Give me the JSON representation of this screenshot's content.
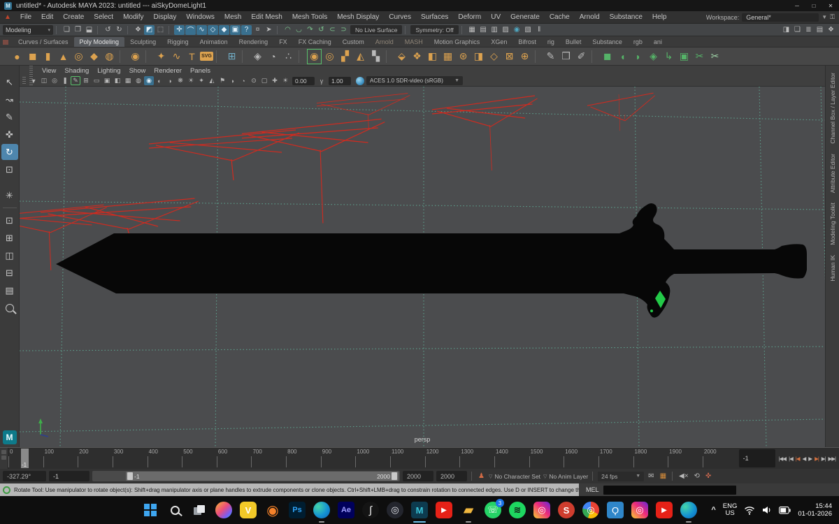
{
  "colors": {
    "viewport_bg": "#4b4c4e",
    "grid": "#5fa893",
    "wire": "#cf2b20",
    "sword": "#070707",
    "gem": "#23c948",
    "accent": "#4e86ad"
  },
  "window": {
    "title": "untitled* - Autodesk MAYA 2023: untitled --- aiSkyDomeLight1",
    "minimize": "─",
    "maximize": "□",
    "close": "✕"
  },
  "menubar": {
    "items": [
      "File",
      "Edit",
      "Create",
      "Select",
      "Modify",
      "Display",
      "Windows",
      "Mesh",
      "Edit Mesh",
      "Mesh Tools",
      "Mesh Display",
      "Curves",
      "Surfaces",
      "Deform",
      "UV",
      "Generate",
      "Cache",
      "Arnold",
      "Substance",
      "Help"
    ],
    "workspace_label": "Workspace:",
    "workspace_value": "General*"
  },
  "statusline": {
    "mode": "Modeling",
    "no_live_surface": "No Live Surface",
    "symmetry": "Symmetry: Off",
    "file_icons": [
      {
        "name": "new-scene-icon",
        "glyph": "❏"
      },
      {
        "name": "open-scene-icon",
        "glyph": "❐"
      },
      {
        "name": "save-scene-icon",
        "glyph": "⬓"
      }
    ],
    "edit_icons": [
      {
        "name": "undo-icon",
        "glyph": "↺"
      },
      {
        "name": "redo-icon",
        "glyph": "↻"
      }
    ],
    "mask_icons": [
      {
        "name": "select-hierarchy-icon",
        "glyph": "❖"
      },
      {
        "name": "select-object-icon",
        "glyph": "◩",
        "state": "active"
      },
      {
        "name": "select-component-icon",
        "glyph": "⬚"
      }
    ],
    "snap_icons": [
      {
        "name": "snap-grid-icon",
        "glyph": "✛",
        "state": "active"
      },
      {
        "name": "snap-curve-icon",
        "glyph": "⌒",
        "state": "active"
      },
      {
        "name": "snap-point-icon",
        "glyph": "∿",
        "state": "active"
      },
      {
        "name": "snap-projected-center-icon",
        "glyph": "◇",
        "state": "active"
      },
      {
        "name": "snap-view-plane-icon",
        "glyph": "◆",
        "state": "active"
      },
      {
        "name": "make-live-icon",
        "glyph": "▣",
        "state": "active"
      },
      {
        "name": "snap-help-icon",
        "glyph": "?",
        "state": "active"
      },
      {
        "name": "lock-selection-icon",
        "glyph": "¤"
      },
      {
        "name": "highlight-selection-icon",
        "glyph": "➤"
      }
    ],
    "surf_icons": [
      {
        "name": "construction-history-icon",
        "glyph": "◠",
        "color": "#7fc98f"
      },
      {
        "name": "curve-arc-icon",
        "glyph": "◡",
        "color": "#7fc98f"
      },
      {
        "name": "curve-redo-icon",
        "glyph": "↷",
        "color": "#7fc98f"
      },
      {
        "name": "curve-undo-icon",
        "glyph": "↺",
        "color": "#7fc98f"
      },
      {
        "name": "surface-open-icon",
        "glyph": "⊂",
        "color": "#7fc98f"
      },
      {
        "name": "surface-close-icon",
        "glyph": "⊃",
        "color": "#7fc98f"
      }
    ],
    "editor_icons": [
      {
        "name": "render-view-icon",
        "glyph": "▦"
      },
      {
        "name": "render-current-frame-icon",
        "glyph": "▤"
      },
      {
        "name": "ipr-render-icon",
        "glyph": "▥"
      },
      {
        "name": "render-settings-icon",
        "glyph": "▨"
      },
      {
        "name": "hypershade-icon",
        "glyph": "◉",
        "color": "#4fa8c2"
      },
      {
        "name": "light-editor-icon",
        "glyph": "▧"
      },
      {
        "name": "pause-viewport-icon",
        "glyph": "‖"
      }
    ],
    "sidebar_icons": [
      {
        "name": "modeling-toolkit-toggle-icon",
        "glyph": "◨"
      },
      {
        "name": "humanik-toggle-icon",
        "glyph": "❏"
      },
      {
        "name": "attribute-editor-toggle-icon",
        "glyph": "≣"
      },
      {
        "name": "tool-settings-toggle-icon",
        "glyph": "▤"
      },
      {
        "name": "channel-box-toggle-icon",
        "glyph": "❖"
      }
    ]
  },
  "shelf": {
    "tabs": [
      {
        "label": "Curves / Surfaces"
      },
      {
        "label": "Poly Modeling",
        "state": "active"
      },
      {
        "label": "Sculpting"
      },
      {
        "label": "Rigging"
      },
      {
        "label": "Animation"
      },
      {
        "label": "Rendering"
      },
      {
        "label": "FX"
      },
      {
        "label": "FX Caching"
      },
      {
        "label": "Custom"
      },
      {
        "label": "Arnold",
        "state": "dim"
      },
      {
        "label": "MASH",
        "state": "dim"
      },
      {
        "label": "Motion Graphics"
      },
      {
        "label": "XGen"
      },
      {
        "label": "Bifrost"
      },
      {
        "label": "rig"
      },
      {
        "label": "Bullet"
      },
      {
        "label": "Substance"
      },
      {
        "label": "rgb"
      },
      {
        "label": "ani"
      }
    ],
    "icons": [
      {
        "name": "poly-sphere-icon",
        "glyph": "●"
      },
      {
        "name": "poly-cube-icon",
        "glyph": "◼"
      },
      {
        "name": "poly-cylinder-icon",
        "glyph": "▮"
      },
      {
        "name": "poly-cone-icon",
        "glyph": "▲"
      },
      {
        "name": "poly-torus-icon",
        "glyph": "◎"
      },
      {
        "name": "poly-plane-icon",
        "glyph": "◆"
      },
      {
        "name": "poly-disc-icon",
        "glyph": "◍"
      },
      {
        "cls": "shelf-sep"
      },
      {
        "name": "platonic-solid-icon",
        "glyph": "◉"
      },
      {
        "cls": "shelf-sep"
      },
      {
        "name": "star-icon",
        "glyph": "✦"
      },
      {
        "name": "curve-tool-icon",
        "glyph": "∿"
      },
      {
        "name": "type-tool-icon",
        "glyph": "T"
      },
      {
        "name": "svg-tool-icon",
        "glyph": "SVG",
        "cls": "shelf-icon shelf-badge"
      },
      {
        "cls": "shelf-sep"
      },
      {
        "name": "sweep-mesh-icon",
        "glyph": "⊞",
        "color": "#71aec7"
      },
      {
        "cls": "shelf-sep"
      },
      {
        "name": "construction-plane-icon",
        "glyph": "◈",
        "color": "#b9b9b9"
      },
      {
        "name": "time-node-icon",
        "glyph": "◔",
        "color": "#b9b9b9"
      },
      {
        "name": "measure-tool-icon",
        "glyph": "∴",
        "color": "#b9b9b9"
      },
      {
        "cls": "shelf-sep"
      },
      {
        "name": "smooth-mesh-icon",
        "glyph": "◉",
        "state": "outlined"
      },
      {
        "name": "subdiv-proxy-icon",
        "glyph": "◎"
      },
      {
        "name": "quad-draw-icon",
        "glyph": "▞"
      },
      {
        "name": "mirror-icon",
        "glyph": "◭"
      },
      {
        "name": "retopo-icon",
        "glyph": "▚",
        "color": "#b9b9b9"
      },
      {
        "cls": "shelf-sep"
      },
      {
        "name": "bevel-icon",
        "glyph": "⬙"
      },
      {
        "name": "bridge-icon",
        "glyph": "❖"
      },
      {
        "name": "extrude-icon",
        "glyph": "◧"
      },
      {
        "name": "multi-cut-icon",
        "glyph": "▦"
      },
      {
        "name": "wheel-icon",
        "glyph": "⊛"
      },
      {
        "name": "fold-plane-icon",
        "glyph": "◨"
      },
      {
        "name": "combine-icon",
        "glyph": "◇"
      },
      {
        "name": "boolean-icon",
        "glyph": "⊠"
      },
      {
        "name": "target-weld-icon",
        "glyph": "⊕"
      },
      {
        "cls": "shelf-sep"
      },
      {
        "name": "crease-tool-icon",
        "glyph": "✎",
        "color": "#b9b9b9"
      },
      {
        "name": "notebook-icon",
        "glyph": "❒",
        "color": "#b9b9b9"
      },
      {
        "name": "sculpt-pen-icon",
        "glyph": "✐",
        "color": "#b9b9b9"
      },
      {
        "cls": "shelf-sep"
      },
      {
        "name": "uv-planar-icon",
        "glyph": "◼",
        "color": "#55b368"
      },
      {
        "name": "uv-camera-icon",
        "glyph": "◖",
        "color": "#55b368"
      },
      {
        "name": "uv-cylindrical-icon",
        "glyph": "◗",
        "color": "#55b368"
      },
      {
        "name": "uv-spherical-icon",
        "glyph": "◈",
        "color": "#55b368"
      },
      {
        "name": "uv-unfold-icon",
        "glyph": "↳",
        "color": "#55b368"
      },
      {
        "name": "uv-editor-icon",
        "glyph": "▣",
        "color": "#55b368"
      },
      {
        "name": "uv-cut-icon",
        "glyph": "✂",
        "color": "#55b368"
      },
      {
        "name": "uv-sew-icon",
        "glyph": "✂",
        "color": "#9fd4a8"
      }
    ]
  },
  "toolbox": {
    "tools": [
      {
        "name": "select-tool-icon",
        "glyph": "↖"
      },
      {
        "name": "lasso-select-tool-icon",
        "glyph": "↝"
      },
      {
        "name": "paint-select-tool-icon",
        "glyph": "✎"
      },
      {
        "name": "move-tool-icon",
        "glyph": "✜"
      },
      {
        "name": "rotate-tool-icon",
        "glyph": "↻",
        "state": "active"
      },
      {
        "name": "scale-tool-icon",
        "glyph": "⊡"
      }
    ],
    "manip": {
      "name": "universal-manipulator-icon",
      "glyph": "✳"
    },
    "layouts": [
      {
        "name": "single-pane-layout-icon",
        "glyph": "⊡"
      },
      {
        "name": "four-pane-layout-icon",
        "glyph": "⊞"
      },
      {
        "name": "two-pane-side-layout-icon",
        "glyph": "◫"
      },
      {
        "name": "two-pane-stacked-layout-icon",
        "glyph": "⊟"
      },
      {
        "name": "outliner-layout-icon",
        "glyph": "▤"
      }
    ]
  },
  "panel": {
    "menus": [
      "View",
      "Shading",
      "Lighting",
      "Show",
      "Renderer",
      "Panels"
    ],
    "toolbar_icons": [
      {
        "name": "camera-select-icon",
        "glyph": "▼"
      },
      {
        "name": "camera-lock-icon",
        "glyph": "◫"
      },
      {
        "name": "camera-attrs-icon",
        "glyph": "◎"
      },
      {
        "name": "bookmark-icon",
        "glyph": "❚"
      },
      {
        "name": "image-plane-icon",
        "glyph": "✎",
        "state": "outlined"
      },
      {
        "name": "view-grid-icon",
        "glyph": "⊞"
      },
      {
        "name": "film-gate-icon",
        "glyph": "▭"
      },
      {
        "name": "resolution-gate-icon",
        "glyph": "▣"
      },
      {
        "name": "gate-mask-icon",
        "glyph": "◧"
      },
      {
        "name": "field-chart-icon",
        "glyph": "▦"
      },
      {
        "name": "safe-action-icon",
        "glyph": "◍"
      },
      {
        "name": "textured-icon",
        "glyph": "◉",
        "state": "active"
      },
      {
        "name": "wireframe-icon",
        "glyph": "◐"
      },
      {
        "name": "shaded-icon",
        "glyph": "◑"
      },
      {
        "name": "use-default-material-icon",
        "glyph": "❋"
      },
      {
        "name": "lighting-icon",
        "glyph": "☀"
      },
      {
        "name": "shadows-icon",
        "glyph": "✦"
      },
      {
        "name": "screen-space-ao-icon",
        "glyph": "◭"
      },
      {
        "name": "motion-blur-icon",
        "glyph": "⚑"
      },
      {
        "name": "multisampling-icon",
        "glyph": "◗"
      },
      {
        "name": "depth-of-field-icon",
        "glyph": "◔"
      },
      {
        "name": "isolate-select-icon",
        "glyph": "⊙"
      },
      {
        "name": "xray-icon",
        "glyph": "▢"
      },
      {
        "name": "joints-xray-icon",
        "glyph": "✚"
      }
    ],
    "exposure": "0.00",
    "gamma": "1.00",
    "view_transform": "ACES 1.0 SDR-video (sRGB)",
    "camera_label": "persp"
  },
  "right_tabs": [
    "Channel Box / Layer Editor",
    "Attribute Editor",
    "Modeling Toolkit",
    "Human IK"
  ],
  "timeline": {
    "ticks": [
      "0",
      "100",
      "200",
      "300",
      "400",
      "500",
      "600",
      "700",
      "800",
      "900",
      "1000",
      "1100",
      "1200",
      "1300",
      "1400",
      "1500",
      "1600",
      "1700",
      "1800",
      "1900",
      "2000"
    ],
    "playhead": "-1",
    "current_frame": "-1",
    "playback": [
      {
        "name": "go-to-start-button",
        "glyph": "|◀◀"
      },
      {
        "name": "step-back-frame-button",
        "glyph": "|◀"
      },
      {
        "name": "step-back-key-button",
        "glyph": "|◀",
        "color": "#d4703f"
      },
      {
        "name": "play-backwards-button",
        "glyph": "◀"
      },
      {
        "name": "play-forwards-button",
        "glyph": "▶"
      },
      {
        "name": "step-forward-key-button",
        "glyph": "▶|",
        "color": "#d4703f"
      },
      {
        "name": "step-forward-frame-button",
        "glyph": "▶|"
      },
      {
        "name": "go-to-end-button",
        "glyph": "▶▶|"
      }
    ]
  },
  "range": {
    "numeric_field": "-327.29°",
    "start_field": "-1",
    "range_start_label": "-1",
    "range_end_label": "2000",
    "end_field": "2000",
    "end_field2": "2000",
    "character_set": "No Character Set",
    "anim_layer": "No Anim Layer",
    "fps": "24 fps"
  },
  "helpline": {
    "text": "Rotate Tool: Use manipulator to rotate object(s): Shift+drag manipulator axis or plane handles to extrude components or clone objects. Ctrl+Shift+LMB+drag to constrain rotation to connected edges. Use D or INSERT to change the pivot position and axis orientation.",
    "mel_label": "MEL"
  },
  "taskbar": {
    "apps": [
      {
        "name": "copilot-app-icon",
        "glyph": "",
        "bg": "linear-gradient(135deg,#f7b733,#ec4d7b 45%,#7a5df0 75%,#38b6ff)",
        "radius": "50%"
      },
      {
        "name": "v-app-icon",
        "glyph": "V",
        "bg": "#f2c928",
        "fg": "#ffffff",
        "radius": "6px",
        "fw": "700"
      },
      {
        "name": "blender-app-icon",
        "glyph": "◉",
        "fg": "#f5822a",
        "fs": "20px"
      },
      {
        "name": "photoshop-app-icon",
        "glyph": "Ps",
        "bg": "#001d30",
        "fg": "#2fa3f7",
        "radius": "4px",
        "fs": "11px",
        "fw": "700"
      },
      {
        "name": "edge-app-icon",
        "glyph": "",
        "bg": "radial-gradient(circle at 30% 30%, #45d6a8, #1593d2 55%, #0c63b8)",
        "radius": "50%",
        "state": "running"
      },
      {
        "name": "after-effects-app-icon",
        "glyph": "Ae",
        "bg": "#00005b",
        "fg": "#9b9bff",
        "radius": "4px",
        "fs": "11px",
        "fw": "700"
      },
      {
        "name": "swirl-app-icon",
        "glyph": "∫",
        "bg": "#141414",
        "fg": "#ececec",
        "radius": "50%",
        "fs": "15px"
      },
      {
        "name": "obs-app-icon",
        "glyph": "◎",
        "bg": "#23252d",
        "fg": "#e8eaf0",
        "radius": "50%"
      },
      {
        "name": "maya-app-icon",
        "glyph": "M",
        "bg": "#0d3b4f",
        "fg": "#39c4d8",
        "radius": "4px",
        "fw": "700",
        "state": "focused"
      },
      {
        "name": "youtube-app-icon",
        "glyph": "▶",
        "bg": "#e62117",
        "fg": "#ffffff",
        "radius": "5px",
        "fs": "10px"
      },
      {
        "name": "file-explorer-app-icon",
        "glyph": "▰",
        "fg": "#f0b73f",
        "fs": "19px",
        "state": "running"
      },
      {
        "name": "whatsapp-app-icon",
        "glyph": "☏",
        "bg": "#25d366",
        "fg": "#ffffff",
        "radius": "50%",
        "badge": "3"
      },
      {
        "name": "spotify-app-icon",
        "glyph": "≋",
        "bg": "#1ed760",
        "fg": "#111111",
        "radius": "50%",
        "fw": "700"
      },
      {
        "name": "instagram-app-icon",
        "glyph": "◎",
        "bg": "linear-gradient(45deg,#f9ce34,#ee2a7b 55%,#6228d7)",
        "fg": "#ffffff",
        "radius": "6px"
      },
      {
        "name": "rewards-app-icon",
        "glyph": "S",
        "bg": "#cf3d2e",
        "fg": "#ffffff",
        "radius": "50%",
        "fw": "700"
      },
      {
        "name": "chrome-app-icon",
        "glyph": "◎",
        "bg": "conic-gradient(#e94335 0 120deg,#fbbc05 120deg 200deg,#34a853 200deg 280deg,#4285f4 280deg 360deg)",
        "fg": "#ffffff",
        "radius": "50%"
      },
      {
        "name": "sbi-app-icon",
        "glyph": "Ϙ",
        "bg": "#2f86c9",
        "fg": "#ffffff",
        "radius": "4px"
      },
      {
        "name": "instagram2-app-icon",
        "glyph": "◎",
        "bg": "linear-gradient(45deg,#f9ce34,#ee2a7b 55%,#6228d7)",
        "fg": "#ffffff",
        "radius": "6px"
      },
      {
        "name": "youtube2-app-icon",
        "glyph": "▶",
        "bg": "#e62117",
        "fg": "#ffffff",
        "radius": "5px",
        "fs": "10px"
      },
      {
        "name": "edge2-app-icon",
        "glyph": "",
        "bg": "radial-gradient(circle at 30% 30%, #45d6a8, #1593d2 55%, #0c63b8)",
        "radius": "50%",
        "state": "running"
      }
    ],
    "tray": {
      "chevron": "^",
      "lang_top": "ENG",
      "lang_bottom": "US",
      "time": "15:44",
      "date": "01-01-2026"
    }
  }
}
